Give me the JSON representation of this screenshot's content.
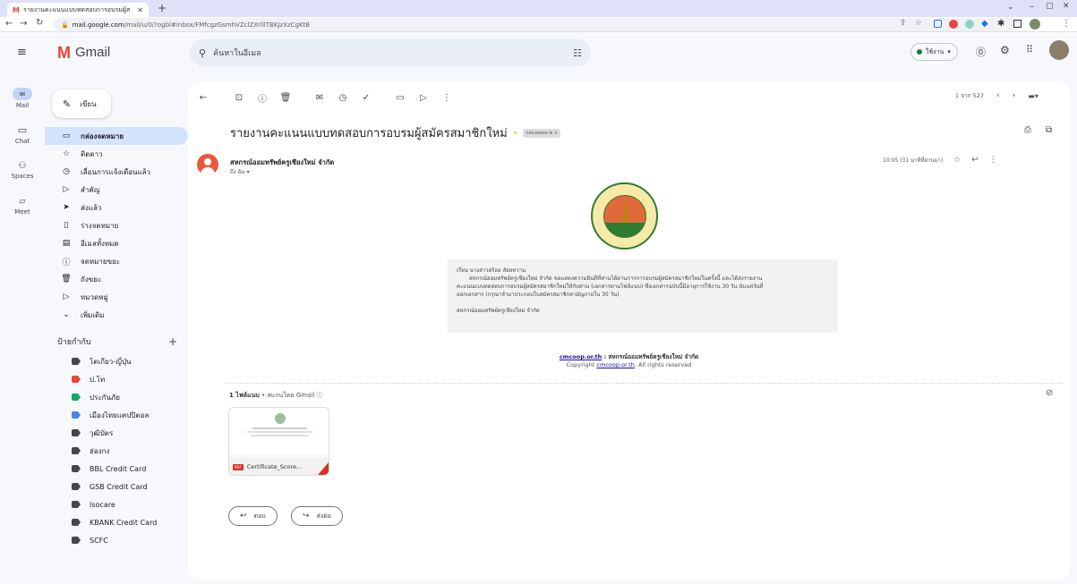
{
  "browser": {
    "tab_title": "รายงานคะแนนแบบทดสอบการอบรมผู้ส",
    "url_host": "mail.google.com",
    "url_path": "/mail/u/0/?ogbl#inbox/FMfcgzGsmhVZclZXrlllTBKJzXzCgKtB"
  },
  "app": {
    "name": "Gmail",
    "search_placeholder": "ค้นหาในอีเมล",
    "status_label": "ใช้งาน"
  },
  "rail": [
    {
      "label": "Mail",
      "icon": "mail-icon"
    },
    {
      "label": "Chat",
      "icon": "chat-icon"
    },
    {
      "label": "Spaces",
      "icon": "spaces-icon"
    },
    {
      "label": "Meet",
      "icon": "meet-icon"
    }
  ],
  "compose_label": "เขียน",
  "nav": [
    {
      "label": "กล่องจดหมาย",
      "icon": "▭",
      "active": true
    },
    {
      "label": "ติดดาว",
      "icon": "☆"
    },
    {
      "label": "เลื่อนการแจ้งเตือนแล้ว",
      "icon": "◷"
    },
    {
      "label": "สำคัญ",
      "icon": "▷"
    },
    {
      "label": "ส่งแล้ว",
      "icon": "➤"
    },
    {
      "label": "ร่างจดหมาย",
      "icon": "▯"
    },
    {
      "label": "อีเมลทั้งหมด",
      "icon": "▤"
    },
    {
      "label": "จดหมายขยะ",
      "icon": "ⓘ"
    },
    {
      "label": "ถังขยะ",
      "icon": "🗑"
    },
    {
      "label": "หมวดหมู่",
      "icon": "▷"
    },
    {
      "label": "เพิ่มเติม",
      "icon": "⌄"
    }
  ],
  "labels_header": "ป้ายกำกับ",
  "labels": [
    {
      "label": "โตเกียว-ญี่ปุ่น",
      "color": "#444746"
    },
    {
      "label": "ป.โท",
      "color": "#e8453c"
    },
    {
      "label": "ประกันภัย",
      "color": "#16a765"
    },
    {
      "label": "เมืองไทยแคปปิตอล",
      "color": "#4a86e8"
    },
    {
      "label": "วุฒิบัตร",
      "color": "#444746"
    },
    {
      "label": "ฮ่องกง",
      "color": "#444746"
    },
    {
      "label": "BBL Credit Card",
      "color": "#444746"
    },
    {
      "label": "GSB Credit Card",
      "color": "#444746"
    },
    {
      "label": "Isocare",
      "color": "#444746"
    },
    {
      "label": "KBANK Credit Card",
      "color": "#444746"
    },
    {
      "label": "SCFC",
      "color": "#444746"
    }
  ],
  "toolbar": {
    "pagination": "1 จาก 527"
  },
  "email": {
    "subject": "รายงานคะแนนแบบทดสอบการอบรมผู้สมัครสมาชิกใหม่",
    "inbox_tag": "กล่องจดหมาย",
    "sender": "สหกรณ์ออมทรัพย์ครูเชียงใหม่ จำกัด",
    "to": "ถึง ฉัน",
    "time": "10:05 (31 นาทีที่ผ่านมา)",
    "body_lines": [
      "เรียน นางสาวสร้อย ลัอยหวาน",
      "สหกรณ์ออมทรัพย์ครูเชียงใหม่ จำกัด ขอแสดงความยินดีที่ท่านได้ผ่านการการอบรมผู้สมัครสมาชิกใหม่ในครั้งนี้ และได้ส่งรายงาน",
      "คะแนนแบบทดสอบการอบรมผู้สมัครสมาชิกใหม่ให้กับท่าน (เอกสารตามไฟล์แนบ) ซึ่งเอกสารฉบับนี้มีอายุการใช้งาน 30 วัน นับแต่วันที่",
      "ออกเอกสาร (กรุณาจำมาประกอบใบสมัครสมาชิกสามัญภายใน 30 วัน)",
      "",
      "สหกรณ์ออมทรัพย์ครูเชียงใหม่ จำกัด"
    ],
    "footer_link": "cmcoop.or.th",
    "footer_org": " : สหกรณ์ออมทรัพย์ครูเชียงใหม่ จำกัด",
    "copyright_prefix": "Copyright ",
    "copyright_link": "cmcoop.or.th",
    "copyright_suffix": ", All rights reserved",
    "attachments_header": "1 ไฟล์แนบ",
    "attachments_scan": " • สแกนโดย Gmail ⓘ",
    "attachment_name": "Certificate_Score...",
    "reply_label": "ตอบ",
    "forward_label": "ส่งต่อ"
  }
}
